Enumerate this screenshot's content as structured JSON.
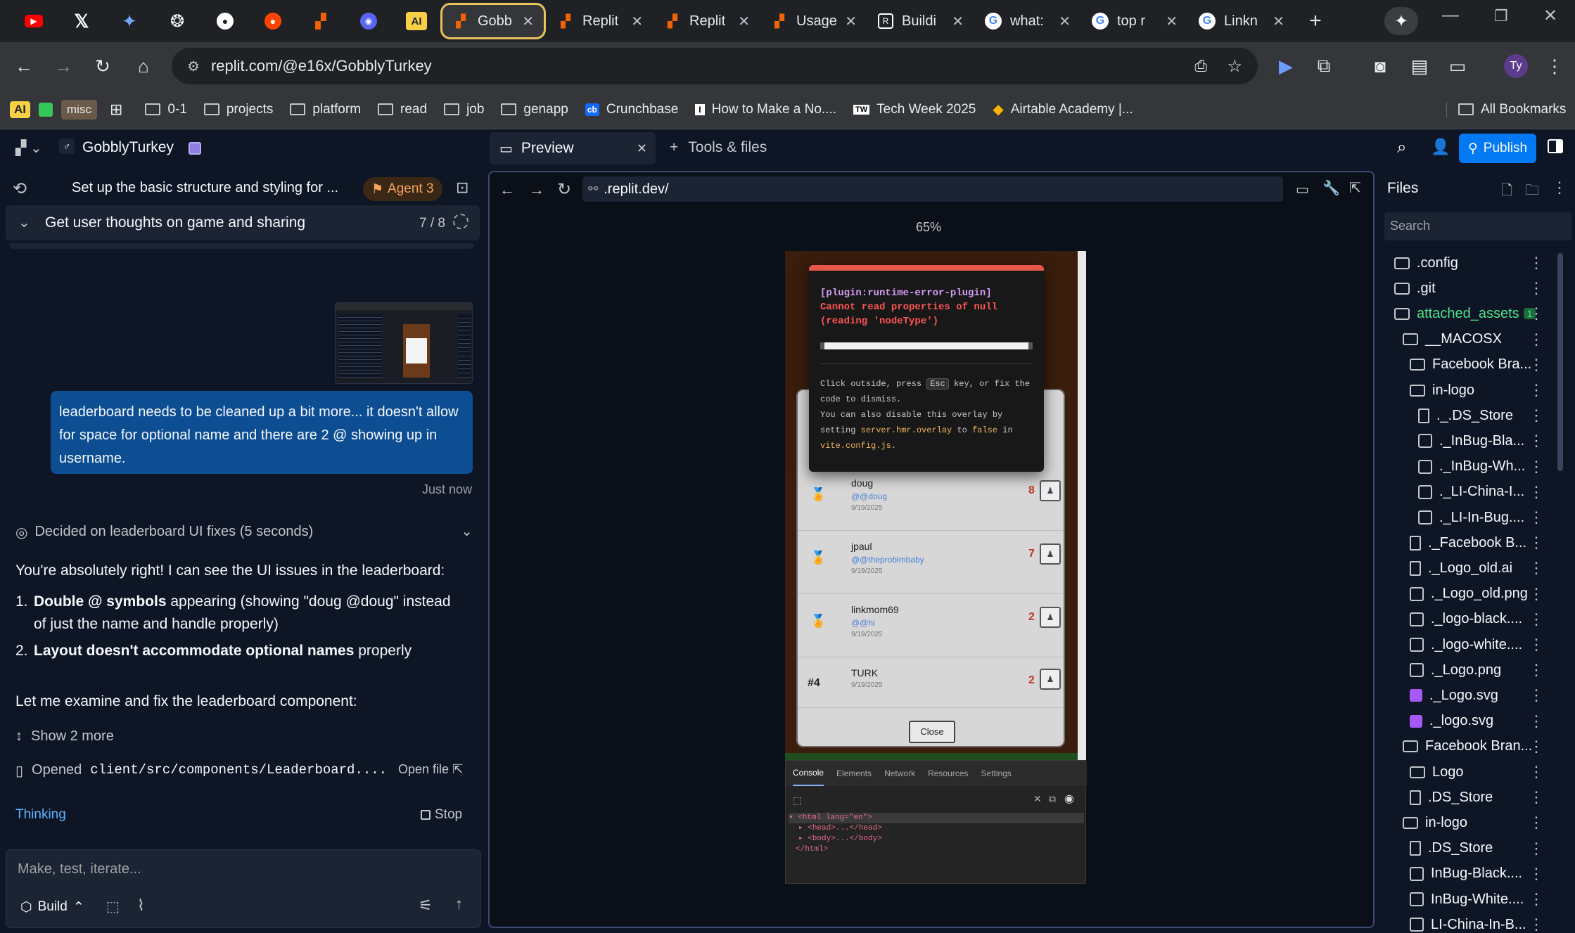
{
  "browser": {
    "tabs": [
      {
        "label": "Gobb",
        "active": true
      },
      {
        "label": "Replit"
      },
      {
        "label": "Replit"
      },
      {
        "label": "Usage"
      },
      {
        "label": "Buildi"
      },
      {
        "label": "what:"
      },
      {
        "label": "top r"
      },
      {
        "label": "Linkn"
      }
    ],
    "url": "replit.com/@e16x/GobblyTurkey",
    "profile_initials": "Ty",
    "bookmarks": [
      "0-1",
      "projects",
      "platform",
      "read",
      "job",
      "genapp",
      "Crunchbase",
      "How to Make a No....",
      "Tech Week 2025",
      "Airtable Academy |..."
    ],
    "bookmark_ai": "AI",
    "bookmark_misc": "misc",
    "all_bookmarks": "All Bookmarks",
    "pinned_ai": "AI"
  },
  "header": {
    "project_name": "GobblyTurkey",
    "preview_tab": "Preview",
    "tools_tab": "Tools & files",
    "publish": "Publish"
  },
  "agent": {
    "task_title": "Set up the basic structure and styling for ...",
    "agent_badge": "Agent 3",
    "progress_title": "Get user thoughts on game and sharing",
    "progress_count": "7 / 8",
    "user_message": "leaderboard needs to be cleaned up a bit more... it doesn't allow for space for optional name and there are 2 @ showing up in username.",
    "timestamp": "Just now",
    "decided": "Decided on leaderboard UI fixes (5 seconds)",
    "reply_intro": "You're absolutely right! I can see the UI issues in the leaderboard:",
    "issue1_bold": "Double @ symbols",
    "issue1_rest": " appearing (showing \"doug @doug\" instead of just the name and handle properly)",
    "issue2_bold": "Layout doesn't accommodate optional names",
    "issue2_rest": " properly",
    "examine": "Let me examine and fix the leaderboard component:",
    "show_more": "Show 2 more",
    "opened_label": "Opened",
    "opened_path": "client/src/components/Leaderboard....",
    "open_file": "Open file",
    "thinking": "Thinking",
    "stop": "Stop",
    "input_placeholder": "Make, test, iterate...",
    "build": "Build"
  },
  "preview": {
    "url": ".replit.dev/",
    "zoom": "65%",
    "error_title": "[plugin:runtime-error-plugin]",
    "error_msg1": "Cannot read properties of null",
    "error_msg2": "(reading 'nodeType')",
    "dismiss1a": "Click outside, press",
    "dismiss_key": "Esc",
    "dismiss1b": "key, or fix the",
    "dismiss2": "code to dismiss.",
    "disable1": "You can also disable this overlay by",
    "disable2a": "setting",
    "disable_setting": "server.hmr.overlay",
    "disable2b": "to",
    "disable_false": "false",
    "disable2c": "in",
    "disable_file": "vite.config.js",
    "disable_period": ".",
    "leaderboard": [
      {
        "name": "doug",
        "handle": "@@doug",
        "date": "9/19/2025",
        "score": "8",
        "medal": "gold"
      },
      {
        "name": "jpaul",
        "handle": "@@theproblmbaby",
        "date": "9/19/2025",
        "score": "7",
        "medal": "silver"
      },
      {
        "name": "linkmom69",
        "handle": "@@hi",
        "date": "9/19/2025",
        "score": "2",
        "medal": "bronze"
      },
      {
        "rank": "#4",
        "name": "TURK",
        "date": "9/19/2025",
        "score": "2"
      }
    ],
    "close": "Close",
    "devtools_tabs": [
      "Console",
      "Elements",
      "Network",
      "Resources",
      "Settings"
    ],
    "dom_lines": [
      "<html lang=\"en\">",
      "<head>...</head>",
      "<body>...</body>",
      "</html>"
    ]
  },
  "files": {
    "title": "Files",
    "search_placeholder": "Search",
    "items": [
      {
        "name": ".config",
        "type": "folder",
        "depth": 0
      },
      {
        "name": ".git",
        "type": "folder",
        "depth": 0
      },
      {
        "name": "attached_assets",
        "type": "folder-open",
        "depth": 0,
        "badge": "1",
        "color": "#4ee28a"
      },
      {
        "name": "__MACOSX",
        "type": "folder-open",
        "depth": 1
      },
      {
        "name": "Facebook Bra...",
        "type": "folder",
        "depth": 2
      },
      {
        "name": "in-logo",
        "type": "folder-open",
        "depth": 2
      },
      {
        "name": "._.DS_Store",
        "type": "file",
        "depth": 3
      },
      {
        "name": "._InBug-Bla...",
        "type": "img",
        "depth": 3
      },
      {
        "name": "._InBug-Wh...",
        "type": "img",
        "depth": 3
      },
      {
        "name": "._LI-China-I...",
        "type": "img",
        "depth": 3
      },
      {
        "name": "._LI-In-Bug....",
        "type": "img",
        "depth": 3
      },
      {
        "name": "._Facebook B...",
        "type": "file",
        "depth": 2
      },
      {
        "name": "._Logo_old.ai",
        "type": "file",
        "depth": 2
      },
      {
        "name": "._Logo_old.png",
        "type": "img",
        "depth": 2
      },
      {
        "name": "._logo-black....",
        "type": "img",
        "depth": 2
      },
      {
        "name": "._logo-white....",
        "type": "img",
        "depth": 2
      },
      {
        "name": "._Logo.png",
        "type": "img",
        "depth": 2
      },
      {
        "name": "._Logo.svg",
        "type": "svg",
        "depth": 2
      },
      {
        "name": "._logo.svg",
        "type": "svg",
        "depth": 2
      },
      {
        "name": "Facebook Bran...",
        "type": "folder-open",
        "depth": 1
      },
      {
        "name": "Logo",
        "type": "folder",
        "depth": 2
      },
      {
        "name": ".DS_Store",
        "type": "file",
        "depth": 2
      },
      {
        "name": "in-logo",
        "type": "folder-open",
        "depth": 1
      },
      {
        "name": ".DS_Store",
        "type": "file",
        "depth": 2
      },
      {
        "name": "InBug-Black....",
        "type": "img",
        "depth": 2
      },
      {
        "name": "InBug-White....",
        "type": "img",
        "depth": 2
      },
      {
        "name": "LI-China-In-B...",
        "type": "img",
        "depth": 2
      }
    ]
  }
}
